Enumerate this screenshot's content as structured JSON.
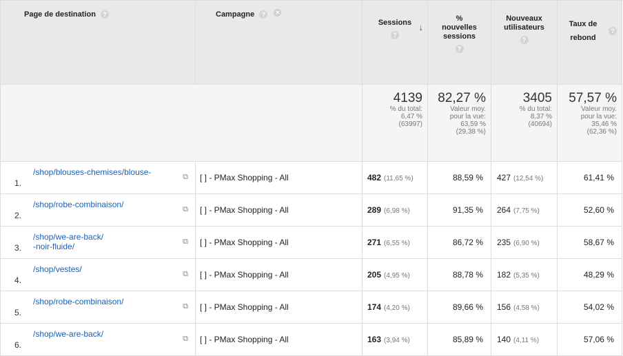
{
  "headers": {
    "page": "Page de destination",
    "campaign": "Campagne",
    "sessions": "Sessions",
    "new_sessions_pct": "% nouvelles sessions",
    "new_users": "Nouveaux utilisateurs",
    "bounce": "Taux de rebond"
  },
  "totals": {
    "sessions": {
      "value": "4139",
      "sub1": "% du total:",
      "sub2": "6,47 %",
      "sub3": "(63997)"
    },
    "new_sessions_pct": {
      "value": "82,27 %",
      "sub1": "Valeur moy.",
      "sub2": "pour la vue:",
      "sub3": "63,59 %",
      "sub4": "(29,38 %)"
    },
    "new_users": {
      "value": "3405",
      "sub1": "% du total:",
      "sub2": "8,37 %",
      "sub3": "(40694)"
    },
    "bounce": {
      "value": "57,57 %",
      "sub1": "Valeur moy.",
      "sub2": "pour la vue:",
      "sub3": "35,46 %",
      "sub4": "(62,36 %)"
    }
  },
  "rows": [
    {
      "rank": "1.",
      "page": "/shop/blouses-chemises/blouse-",
      "campaign": "[     ] - PMax Shopping - All",
      "sessions": "482",
      "sessions_pct": "(11,65 %)",
      "new_pct": "88,59 %",
      "new_users": "427",
      "new_users_pct": "(12,54 %)",
      "bounce": "61,41 %"
    },
    {
      "rank": "2.",
      "page": "/shop/robe-combinaison/",
      "campaign": "[     ] - PMax Shopping - All",
      "sessions": "289",
      "sessions_pct": "(6,98 %)",
      "new_pct": "91,35 %",
      "new_users": "264",
      "new_users_pct": "(7,75 %)",
      "bounce": "52,60 %"
    },
    {
      "rank": "3.",
      "page": "/shop/we-are-back/\n-noir-fluide/",
      "campaign": "[     ] - PMax Shopping - All",
      "sessions": "271",
      "sessions_pct": "(6,55 %)",
      "new_pct": "86,72 %",
      "new_users": "235",
      "new_users_pct": "(6,90 %)",
      "bounce": "58,67 %"
    },
    {
      "rank": "4.",
      "page": "/shop/vestes/",
      "campaign": "[     ] - PMax Shopping - All",
      "sessions": "205",
      "sessions_pct": "(4,95 %)",
      "new_pct": "88,78 %",
      "new_users": "182",
      "new_users_pct": "(5,35 %)",
      "bounce": "48,29 %"
    },
    {
      "rank": "5.",
      "page": "/shop/robe-combinaison/",
      "campaign": "[     ] - PMax Shopping - All",
      "sessions": "174",
      "sessions_pct": "(4,20 %)",
      "new_pct": "89,66 %",
      "new_users": "156",
      "new_users_pct": "(4,58 %)",
      "bounce": "54,02 %"
    },
    {
      "rank": "6.",
      "page": "/shop/we-are-back/",
      "campaign": "[     ] - PMax Shopping - All",
      "sessions": "163",
      "sessions_pct": "(3,94 %)",
      "new_pct": "85,89 %",
      "new_users": "140",
      "new_users_pct": "(4,11 %)",
      "bounce": "57,06 %"
    }
  ],
  "icons": {
    "help": "help-circle-icon",
    "remove": "remove-x-icon",
    "sort": "sort-down-arrow-icon",
    "external": "external-link-icon"
  },
  "colors": {
    "link": "#1a5fb4",
    "header_bg": "#e9e9e9",
    "total_bg": "#f5f5f5"
  }
}
